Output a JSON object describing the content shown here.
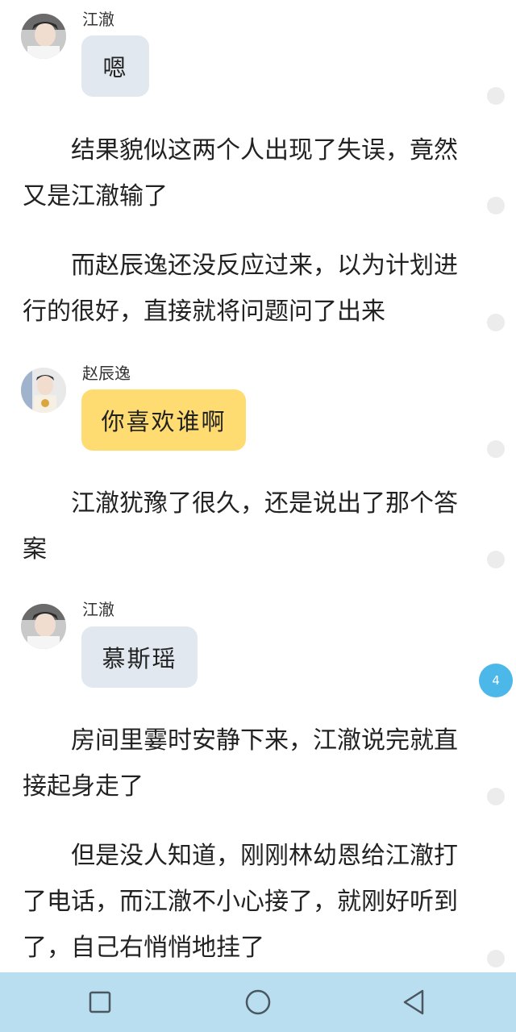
{
  "messages": [
    {
      "sender": "江澈",
      "text": "嗯"
    },
    {
      "sender": "赵辰逸",
      "text": "你喜欢谁啊"
    },
    {
      "sender": "江澈",
      "text": "慕斯瑶"
    }
  ],
  "paragraphs": [
    "结果貌似这两个人出现了失误，竟然又是江澈输了",
    "而赵辰逸还没反应过来，以为计划进行的很好，直接就将问题问了出来",
    "江澈犹豫了很久，还是说出了那个答案",
    "房间里霎时安静下来，江澈说完就直接起身走了",
    "但是没人知道，刚刚林幼恩给江澈打了电话，而江澈不小心接了，就刚好听到了，自己右悄悄地挂了"
  ],
  "comment_badge": "4",
  "colors": {
    "bubble_gray": "#e1e8f0",
    "bubble_yellow": "#ffdc72",
    "badge": "#4cb8ea",
    "navbar": "#b8def0"
  },
  "navbar": {
    "icons": [
      "square-recents-icon",
      "circle-home-icon",
      "triangle-back-icon"
    ]
  }
}
